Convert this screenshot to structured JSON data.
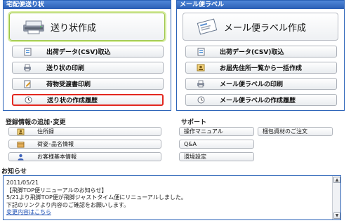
{
  "left_panel": {
    "title": "宅配便送り状",
    "main_button": "送り状作成",
    "buttons": [
      {
        "label": "出荷データ(CSV)取込",
        "icon": "csv-import-icon"
      },
      {
        "label": "送り状の印刷",
        "icon": "printer-icon"
      },
      {
        "label": "荷物受渡書印刷",
        "icon": "document-edit-icon"
      },
      {
        "label": "送り状の作成履歴",
        "icon": "clock-icon"
      }
    ]
  },
  "right_panel": {
    "title": "メール便ラベル",
    "main_button": "メール便ラベル作成",
    "buttons": [
      {
        "label": "出荷データ(CSV)取込",
        "icon": "csv-import-icon"
      },
      {
        "label": "お届先住所一覧から一括作成",
        "icon": "address-book-icon"
      },
      {
        "label": "メール便ラベルの印刷",
        "icon": "printer-icon"
      },
      {
        "label": "メール便ラベルの作成履歴",
        "icon": "clock-icon"
      }
    ]
  },
  "registration": {
    "title": "登録情報の追加･変更",
    "items": [
      "住所録",
      "荷姿･品名情報",
      "お客様基本情報"
    ]
  },
  "support": {
    "title": "サポート",
    "items": [
      "操作マニュアル",
      "梱包資材のご注文",
      "Q&A",
      "環境設定"
    ]
  },
  "news": {
    "title": "お知らせ",
    "lines": [
      "2011/05/21",
      "【飛脚TOP便リニューアルのお知らせ】",
      "5/21より飛脚TOP便が飛脚ジャストタイム便にリニューアルしました。",
      "下記のリンクより内容のご確認をお願いします。"
    ],
    "link_text": "変更内容はこちら"
  },
  "colors": {
    "panel_header": "#2a5fb4",
    "selected_border": "#e3281f",
    "highlight": "#d6ec9e"
  }
}
